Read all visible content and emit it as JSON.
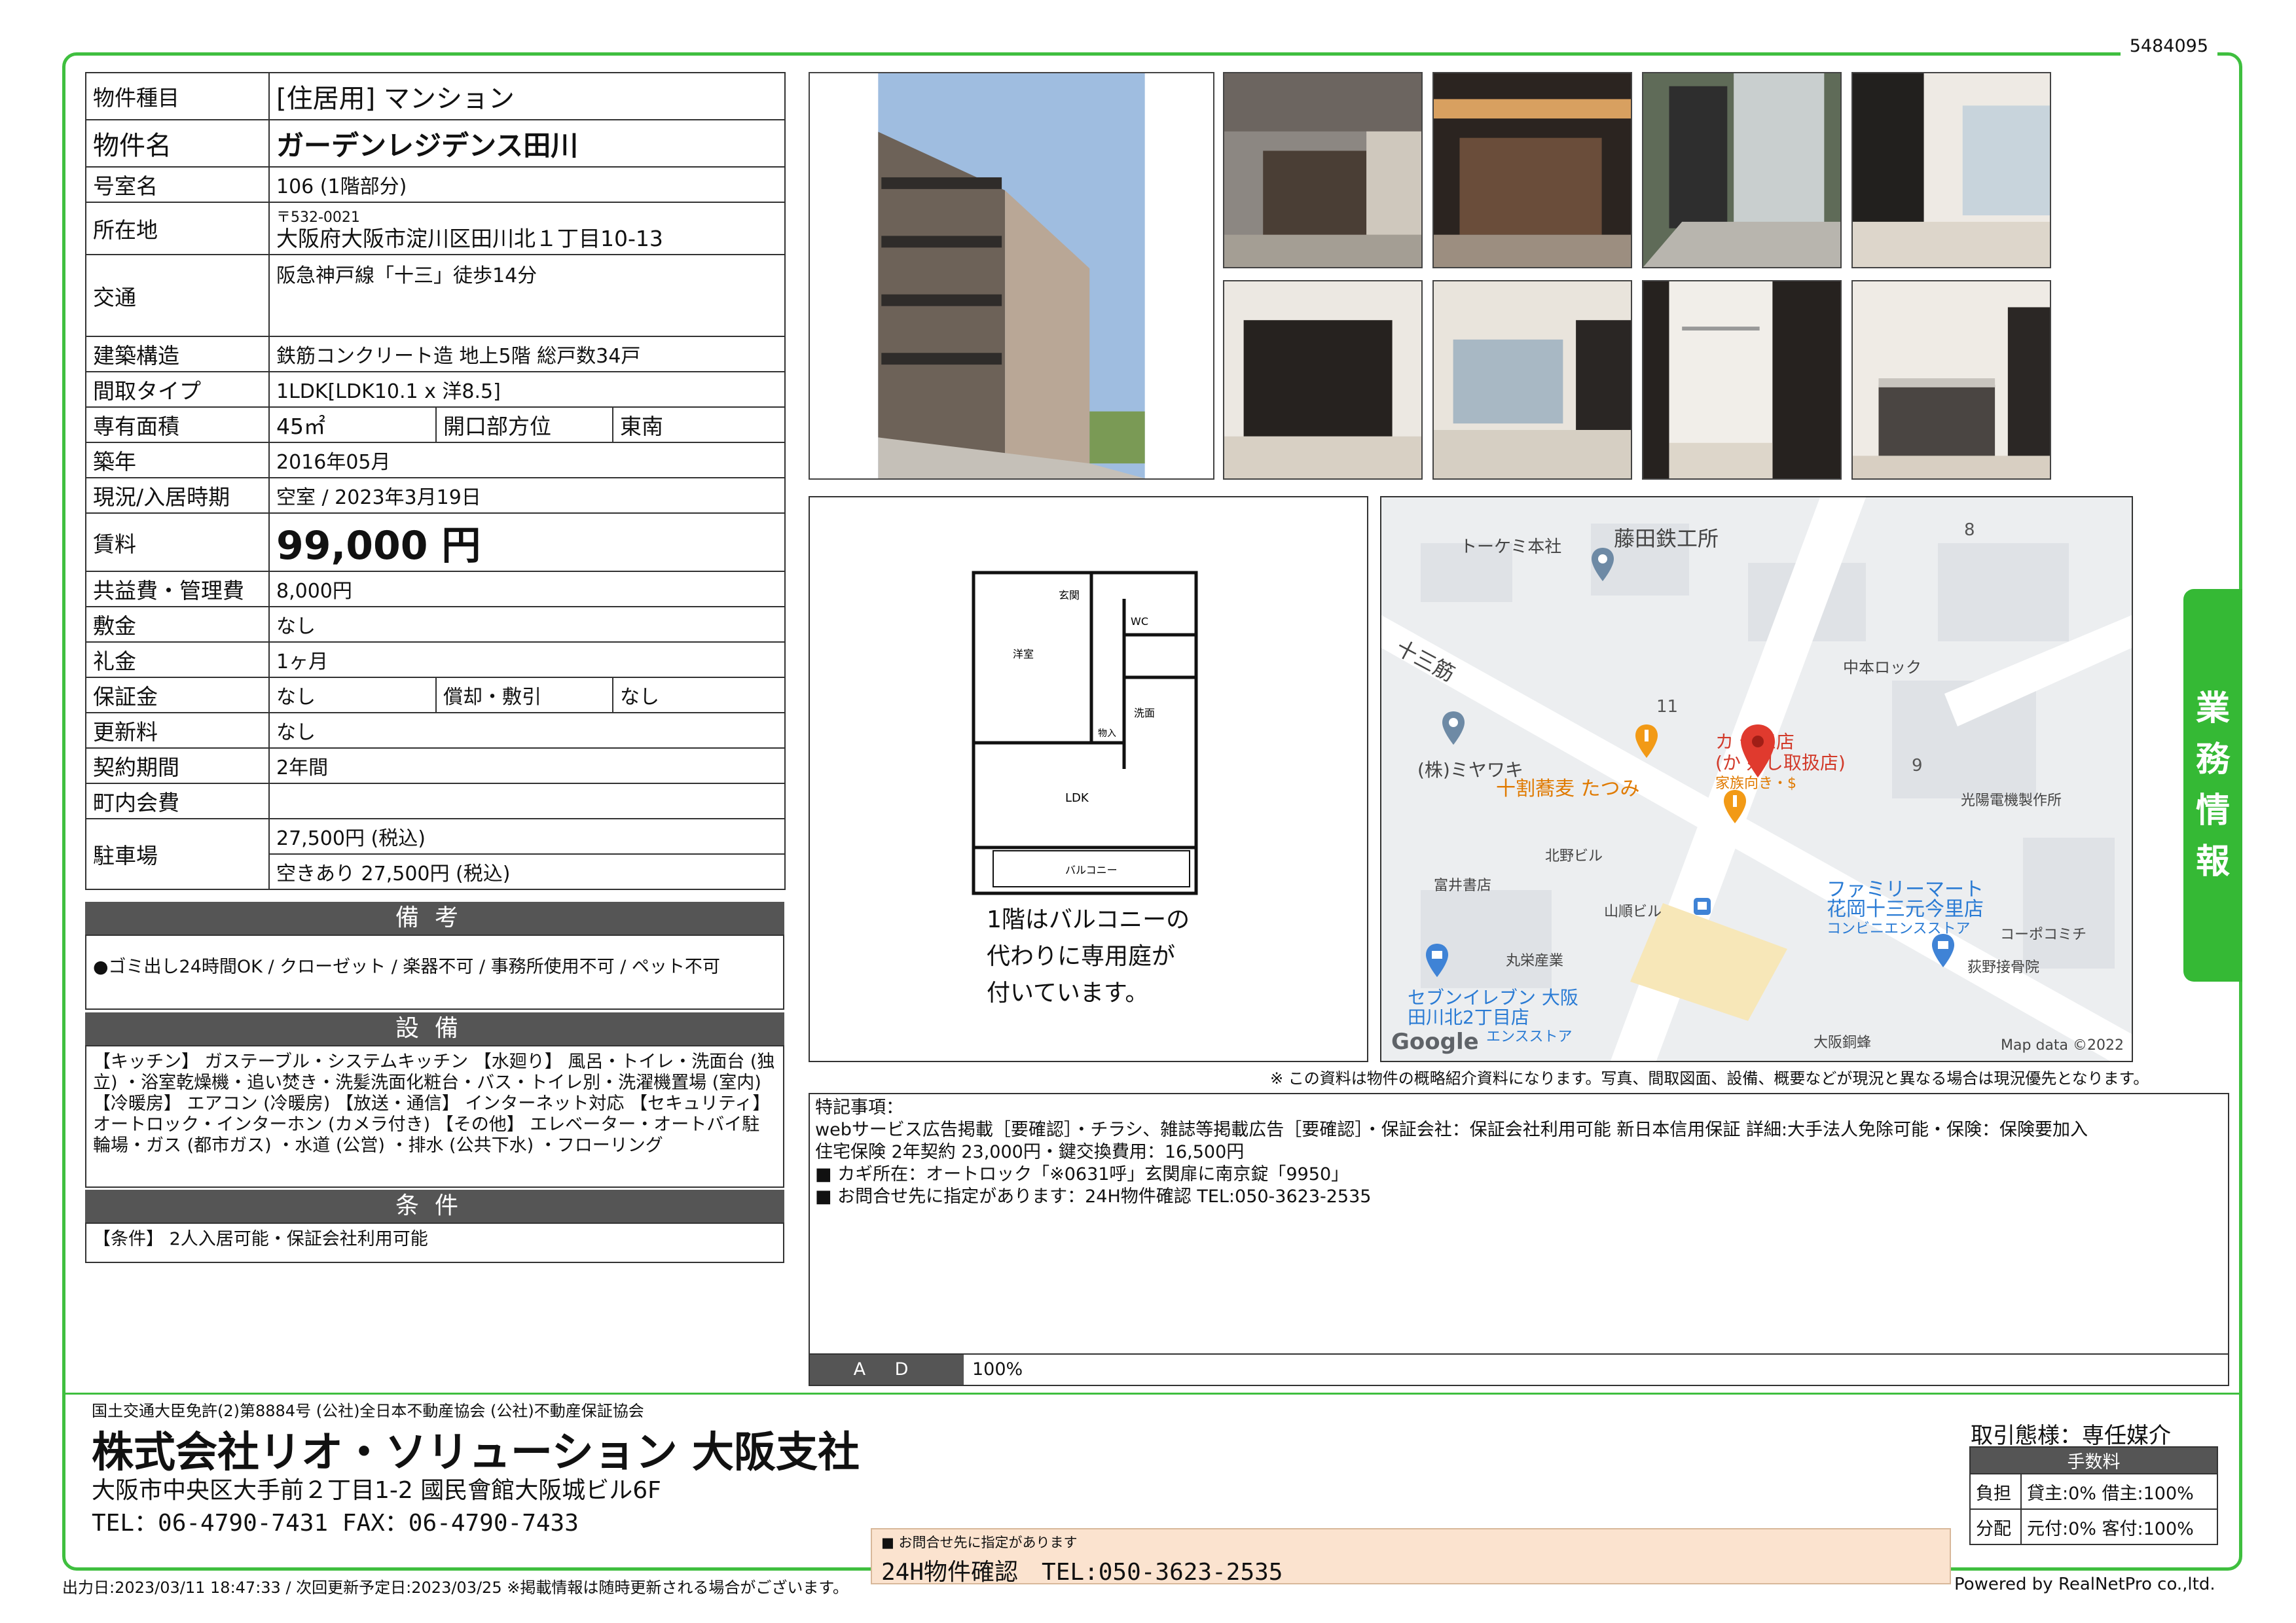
{
  "doc_id": "5484095",
  "property": {
    "type_label": "物件種目",
    "type_value": "[住居用] マンション",
    "name_label": "物件名",
    "name_value": "ガーデンレジデンス田川",
    "room_label": "号室名",
    "room_value": "106 (1階部分)",
    "address_label": "所在地",
    "postal": "〒532-0021",
    "address": "大阪府大阪市淀川区田川北１丁目10-13",
    "transit_label": "交通",
    "transit": "阪急神戸線「十三」徒歩14分",
    "structure_label": "建築構造",
    "structure": "鉄筋コンクリート造 地上5階 総戸数34戸",
    "layout_label": "間取タイプ",
    "layout": "1LDK[LDK10.1 x 洋8.5]",
    "area_label": "専有面積",
    "area": "45㎡",
    "orientation_label": "開口部方位",
    "orientation": "東南",
    "built_label": "築年",
    "built": "2016年05月",
    "status_label": "現況/入居時期",
    "status": "空室 / 2023年3月19日",
    "rent_label": "賃料",
    "rent": "99,000 円",
    "fee_label": "共益費・管理費",
    "fee": "8,000円",
    "deposit_label": "敷金",
    "deposit": "なし",
    "keymoney_label": "礼金",
    "keymoney": "1ヶ月",
    "guarantee_label": "保証金",
    "guarantee": "なし",
    "amort_label": "償却・敷引",
    "amort": "なし",
    "renewal_label": "更新料",
    "renewal": "なし",
    "contract_label": "契約期間",
    "contract": "2年間",
    "assoc_label": "町内会費",
    "assoc": "",
    "parking_label": "駐車場",
    "parking1": "27,500円 (税込)",
    "parking2": "空きあり 27,500円 (税込)"
  },
  "remarks": {
    "title": "備考",
    "text": "●ゴミ出し24時間OK / クローゼット / 楽器不可 / 事務所使用不可 / ペット不可"
  },
  "equipment": {
    "title": "設備",
    "text": "【キッチン】 ガステーブル・システムキッチン 【水廻り】 風呂・トイレ・洗面台 (独立) ・浴室乾燥機・追い焚き・洗髪洗面化粧台・バス・トイレ別・洗濯機置場 (室内) 【冷暖房】 エアコン (冷暖房) 【放送・通信】 インターネット対応 【セキュリティ】 オートロック・インターホン (カメラ付き) 【その他】 エレベーター・オートバイ駐輪場・ガス (都市ガス) ・水道 (公営) ・排水 (公共下水) ・フローリング"
  },
  "conditions": {
    "title": "条件",
    "text": "【条件】 2人入居可能・保証会社利用可能"
  },
  "floorplan": {
    "rooms": {
      "entrance": "玄関",
      "wc": "WC",
      "western": "洋室",
      "storage": "物入",
      "wash": "洗面",
      "ldk": "LDK",
      "balcony": "バルコニー"
    },
    "note_line1": "1階はバルコニーの",
    "note_line2": "代わりに専用庭が",
    "note_line3": "付いています。"
  },
  "map": {
    "labels": {
      "tokemi": "トーケミ本社",
      "fujita": "藤田鉄工所",
      "juso_street": "十三筋",
      "nakamoto": "中本ロック",
      "miyawaki": "(株)ミヤワキ",
      "soba": "十割蕎麦 たつみ",
      "block11": "11",
      "block9": "9",
      "block8": "8",
      "target1": "カ    十三店",
      "target2": "(か  好し取扱店)",
      "target3": "家族向き・$",
      "kitano": "北野ビル",
      "kohyo": "光陽電機製作所",
      "tomii": "富井書店",
      "yamajun": "山順ビル",
      "family1": "ファミリーマート",
      "family2": "花岡十三元今里店",
      "family3": "コンビニエンスストア",
      "maruei": "丸栄産業",
      "cobo": "コーポコミチ",
      "hagino": "荻野接骨院",
      "seven1": "セブンイレブン 大阪",
      "seven2": "田川北2丁目店",
      "seven3": "エンスストア",
      "osaka_dozai": "大阪銅蜂",
      "google": "Google",
      "mapdata": "Map data ©2022"
    },
    "disclaimer": "※ この資料は物件の概略紹介資料になります。写真、間取図面、設備、概要などが現況と異なる場合は現況優先となります。"
  },
  "side_tab": [
    "業",
    "務",
    "情",
    "報"
  ],
  "special_notes": {
    "title": "特記事項：",
    "line1": "webサービス広告掲載［要確認］・チラシ、雑誌等掲載広告［要確認］・保証会社：保証会社利用可能 新日本信用保証 詳細:大手法人免除可能・保険：保険要加入",
    "line2": "住宅保険 2年契約 23,000円・鍵交換費用：16,500円",
    "line3": "■ カギ所在：オートロック「※0631呼」玄関扉に南京錠「9950」",
    "line4": "■ お問合せ先に指定があります：24H物件確認 TEL:050-3623-2535"
  },
  "ad": {
    "label": "A D",
    "value": "100%"
  },
  "company": {
    "license": "国土交通大臣免許(2)第8884号 (公社)全日本不動産協会 (公社)不動産保証協会",
    "name": "株式会社リオ・ソリューション 大阪支社",
    "address": "大阪市中央区大手前２丁目1-2 國民會館大阪城ビル6F",
    "tel": "TEL：06-4790-7431 FAX：06-4790-7433"
  },
  "transaction": {
    "title": "取引態様：専任媒介",
    "fee_header": "手数料",
    "burden_label": "負担",
    "burden_value": "貸主:0% 借主:100%",
    "split_label": "分配",
    "split_value": "元付:0% 客付:100%"
  },
  "contact": {
    "small": "■ お問合せ先に指定があります",
    "big": "24H物件確認　TEL:050-3623-2535"
  },
  "footer": {
    "left": "出力日:2023/03/11 18:47:33 / 次回更新予定日:2023/03/25 ※掲載情報は随時更新される場合がございます。",
    "right": "Powered by RealNetPro co.,ltd."
  }
}
